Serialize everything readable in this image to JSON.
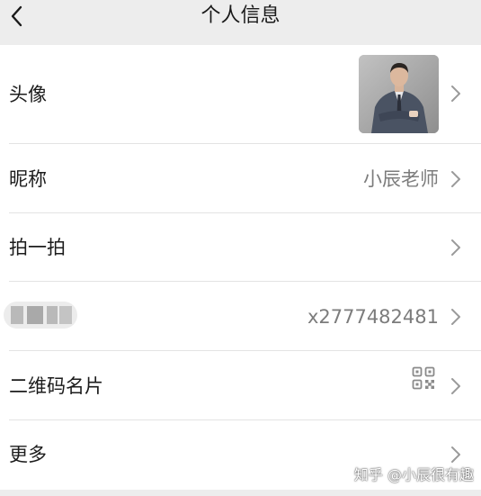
{
  "header": {
    "title": "个人信息"
  },
  "rows": [
    {
      "label": "头像",
      "value": ""
    },
    {
      "label": "昵称",
      "value": "小辰老师"
    },
    {
      "label": "拍一拍",
      "value": ""
    },
    {
      "label": "",
      "value": "x2777482481"
    },
    {
      "label": "二维码名片",
      "value": ""
    },
    {
      "label": "更多",
      "value": ""
    }
  ],
  "icons": {
    "back": "chevron-left-icon",
    "arrow": "chevron-right-icon",
    "qr": "qr-code-icon"
  },
  "watermark": "知乎 @小辰很有趣",
  "colors": {
    "background": "#ededed",
    "row_background": "#ffffff",
    "label_text": "#1c1c1c",
    "value_text": "#7c7c7c",
    "separator": "#e3e3e3",
    "chevron": "#9a9a9a"
  }
}
